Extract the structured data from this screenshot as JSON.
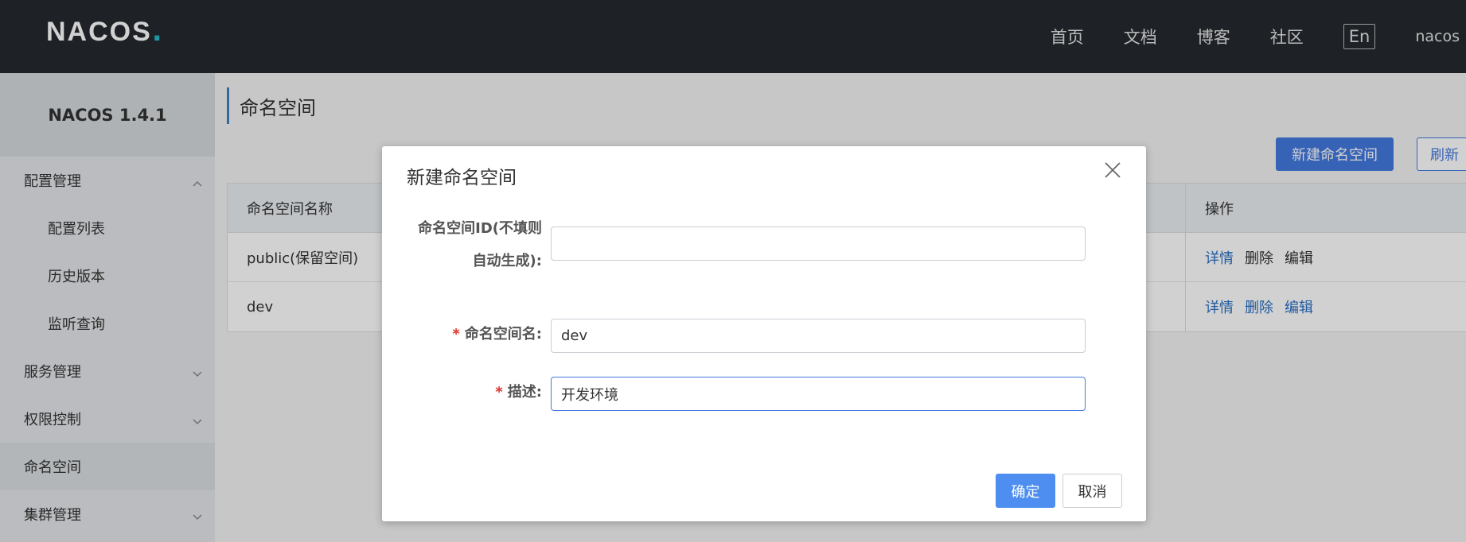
{
  "header": {
    "logo_text": "NACOS",
    "logo_dot": ".",
    "nav": [
      "首页",
      "文档",
      "博客",
      "社区"
    ],
    "lang": "En",
    "user": "nacos"
  },
  "sidebar": {
    "title": "NACOS 1.4.1",
    "items": [
      {
        "label": "配置管理",
        "type": "group",
        "expanded": true
      },
      {
        "label": "配置列表",
        "type": "sub"
      },
      {
        "label": "历史版本",
        "type": "sub"
      },
      {
        "label": "监听查询",
        "type": "sub"
      },
      {
        "label": "服务管理",
        "type": "group",
        "expanded": false
      },
      {
        "label": "权限控制",
        "type": "group",
        "expanded": false
      },
      {
        "label": "命名空间",
        "type": "item",
        "active": true
      },
      {
        "label": "集群管理",
        "type": "group",
        "expanded": false
      }
    ]
  },
  "main": {
    "title": "命名空间",
    "new_button": "新建命名空间",
    "refresh_button": "刷新",
    "table": {
      "headers": [
        "命名空间名称",
        "操作"
      ],
      "rows": [
        {
          "name": "public(保留空间)",
          "ops": [
            "详情",
            "删除",
            "编辑"
          ],
          "ops_colored": [
            true,
            false,
            false
          ]
        },
        {
          "name": "dev",
          "ops": [
            "详情",
            "删除",
            "编辑"
          ],
          "ops_colored": [
            true,
            true,
            true
          ]
        }
      ]
    }
  },
  "dialog": {
    "title": "新建命名空间",
    "fields": {
      "id_label_line1": "命名空间ID(不填则",
      "id_label_line2": "自动生成):",
      "id_value": "",
      "name_label": "命名空间名:",
      "name_value": "dev",
      "desc_label": "描述:",
      "desc_value": "开发环境",
      "required_mark": "*"
    },
    "ok_button": "确定",
    "cancel_button": "取消"
  },
  "colors": {
    "header_bg": "#252a2f",
    "primary": "#4479e0",
    "link": "#2a6fc4",
    "required": "#e0322b"
  }
}
